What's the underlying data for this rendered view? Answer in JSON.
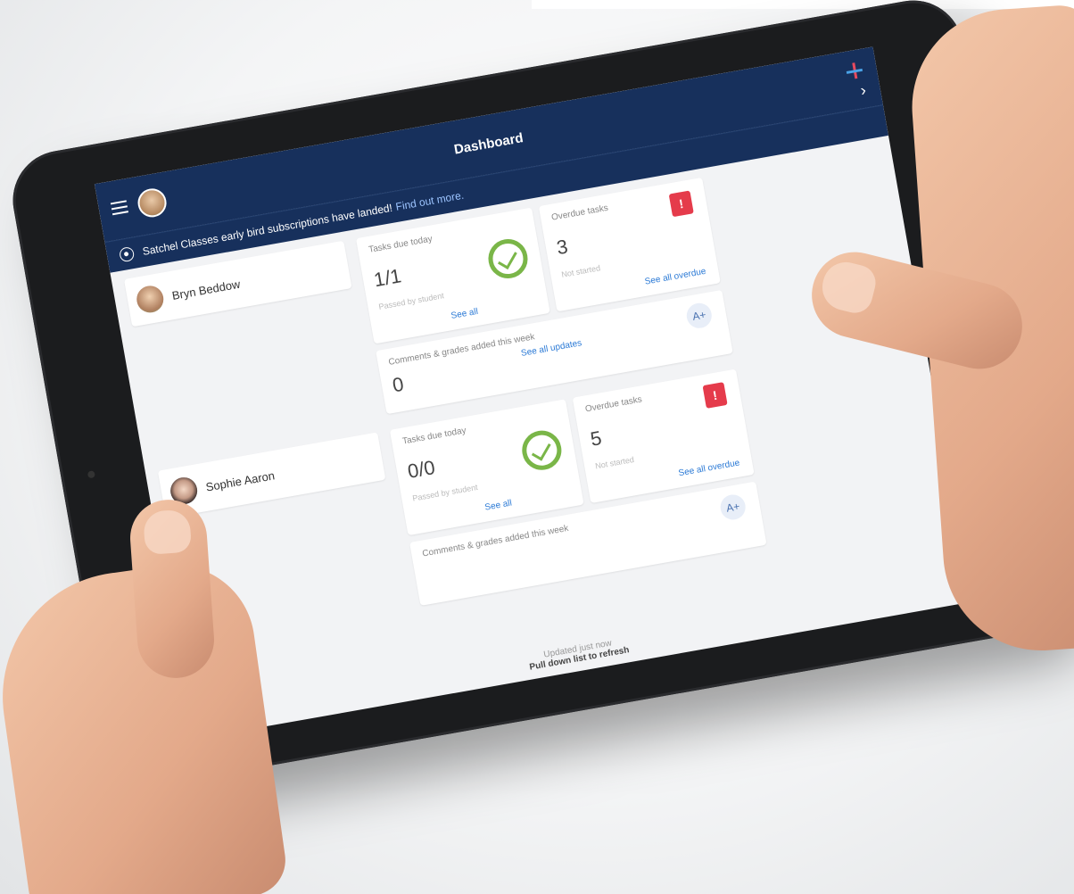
{
  "app": {
    "header_title": "Dashboard",
    "banner_text": "Satchel Classes early bird subscriptions have landed!",
    "banner_link": "Find out more."
  },
  "students": [
    {
      "name": "Bryn Beddow",
      "tasks_label": "Tasks due today",
      "tasks_value": "1/1",
      "tasks_sub": "Passed by student",
      "tasks_link": "See all",
      "overdue_label": "Overdue tasks",
      "overdue_value": "3",
      "overdue_sub": "Not started",
      "overdue_link": "See all overdue",
      "comments_label": "Comments & grades added this week",
      "comments_value": "0",
      "comments_link": "See all updates",
      "grade_badge": "A+"
    },
    {
      "name": "Sophie Aaron",
      "tasks_label": "Tasks due today",
      "tasks_value": "0/0",
      "tasks_sub": "Passed by student",
      "tasks_link": "See all",
      "overdue_label": "Overdue tasks",
      "overdue_value": "5",
      "overdue_sub": "Not started",
      "overdue_link": "See all overdue",
      "comments_label": "Comments & grades added this week",
      "grade_badge": "A+"
    }
  ],
  "refresh": {
    "updated": "Updated just now",
    "pull": "Pull down list to refresh"
  },
  "icons": {
    "menu": "menu-icon",
    "add": "add-icon",
    "chevron": "chevron-right-icon",
    "check": "check-circle-icon",
    "alert": "alert-clipboard-icon",
    "grade": "grade-icon"
  },
  "colors": {
    "header": "#17305c",
    "check": "#7ab648",
    "alert": "#e53b4b",
    "link": "#2d7bd6"
  }
}
